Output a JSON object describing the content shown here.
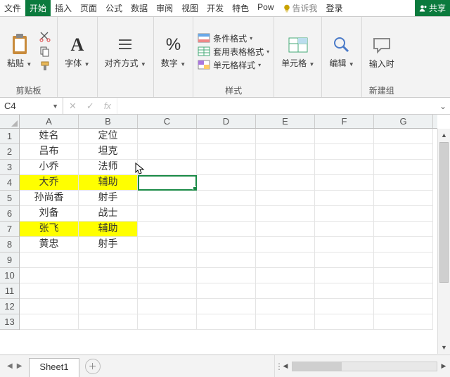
{
  "menu": {
    "tabs": [
      "文件",
      "开始",
      "插入",
      "页面",
      "公式",
      "数据",
      "审阅",
      "视图",
      "开发",
      "特色",
      "Pow"
    ],
    "active_index": 1,
    "tell_me": "告诉我",
    "login": "登录",
    "share": "共享"
  },
  "ribbon": {
    "clipboard": {
      "paste": "粘贴",
      "label": "剪贴板"
    },
    "font": {
      "btn": "字体"
    },
    "align": {
      "btn": "对齐方式"
    },
    "number": {
      "btn": "数字"
    },
    "styles": {
      "conditional": "条件格式",
      "table_fmt": "套用表格格式",
      "cell_style": "单元格样式",
      "label": "样式"
    },
    "cells": {
      "btn": "单元格"
    },
    "editing": {
      "btn": "编辑"
    },
    "newgrp": {
      "btn": "输入时",
      "label": "新建组"
    }
  },
  "fx": {
    "namebox": "C4"
  },
  "sheet": {
    "columns": [
      "A",
      "B",
      "C",
      "D",
      "E",
      "F",
      "G"
    ],
    "row_count": 13,
    "highlight_rows": [
      4,
      7
    ],
    "selected": "C4",
    "cursor_after": {
      "row": 3,
      "col": "B"
    },
    "data": [
      {
        "A": "姓名",
        "B": "定位"
      },
      {
        "A": "吕布",
        "B": "坦克"
      },
      {
        "A": "小乔",
        "B": "法师"
      },
      {
        "A": "大乔",
        "B": "辅助"
      },
      {
        "A": "孙尚香",
        "B": "射手"
      },
      {
        "A": "刘备",
        "B": "战士"
      },
      {
        "A": "张飞",
        "B": "辅助"
      },
      {
        "A": "黄忠",
        "B": "射手"
      }
    ],
    "tab": "Sheet1"
  }
}
